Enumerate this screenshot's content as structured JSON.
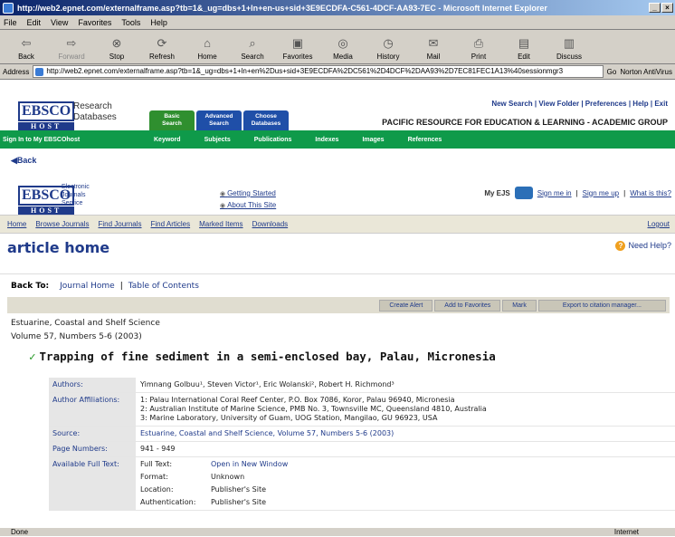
{
  "window": {
    "title": "http://web2.epnet.com/externalframe.asp?tb=1&_ug=dbs+1+ln+en-us+sid+3E9ECDFA-C561-4DCF-AA93-7EC - Microsoft Internet Explorer"
  },
  "menu": [
    "File",
    "Edit",
    "View",
    "Favorites",
    "Tools",
    "Help"
  ],
  "toolbar": [
    "Back",
    "Forward",
    "Stop",
    "Refresh",
    "Home",
    "Search",
    "Favorites",
    "Media",
    "History",
    "Mail",
    "Print",
    "Edit",
    "Discuss"
  ],
  "address": {
    "label": "Address",
    "url": "http://web2.epnet.com/externalframe.asp?tb=1&_ug=dbs+1+ln+en%2Dus+sid+3E9ECDFA%2DC561%2D4DCF%2DAA93%2D7EC81FEC1A13%40sessionmgr3",
    "go": "Go",
    "norton": "Norton AntiVirus"
  },
  "ebsco": {
    "research": "Research",
    "databases": "Databases",
    "tabs": [
      {
        "line1": "Basic",
        "line2": "Search"
      },
      {
        "line1": "Advanced",
        "line2": "Search"
      },
      {
        "line1": "Choose",
        "line2": "Databases"
      }
    ],
    "toplinks": "New Search | View Folder | Preferences | Help | Exit",
    "institution": "PACIFIC RESOURCE FOR EDUCATION & LEARNING - ACADEMIC GROUP",
    "signin": "Sign In to My EBSCOhost",
    "subtabs": [
      "Keyword",
      "Subjects",
      "Publications",
      "Indexes",
      "Images",
      "References"
    ]
  },
  "back": "◀Back",
  "ejs": {
    "label1": "Electronic",
    "label2": "Journals",
    "label3": "Service",
    "getting_started": "Getting Started",
    "about": "About This Site",
    "myejs": "My EJS",
    "signin": "Sign me in",
    "signup": "Sign me up",
    "whatis": "What is this?",
    "nav": [
      "Home",
      "Browse Journals",
      "Find Journals",
      "Find Articles",
      "Marked Items",
      "Downloads"
    ],
    "logout": "Logout"
  },
  "page": {
    "title": "article home",
    "help": "Need Help?",
    "backto_label": "Back To:",
    "journal_home": "Journal Home",
    "toc": "Table of Contents",
    "actions": [
      "Create Alert",
      "Add to Favorites",
      "Mark",
      "Export to citation manager..."
    ],
    "journal": "Estuarine, Coastal and Shelf Science",
    "volume": "Volume 57, Numbers 5-6 (2003)",
    "article_title": "Trapping of fine sediment in a semi-enclosed bay, Palau, Micronesia",
    "authors_label": "Authors:",
    "authors": "Yimnang Golbuu¹, Steven Victor¹, Eric Wolanski², Robert H. Richmond³",
    "affil_label": "Author Affiliations:",
    "affil": [
      "1: Palau International Coral Reef Center, P.O. Box 7086, Koror, Palau 96940, Micronesia",
      "2: Australian Institute of Marine Science, PMB No. 3, Townsville MC, Queensland 4810, Australia",
      "3: Marine Laboratory, University of Guam, UOG Station, Mangilao, GU 96923, USA"
    ],
    "source_label": "Source:",
    "source": "Estuarine, Coastal and Shelf Science, Volume 57, Numbers 5-6 (2003)",
    "pages_label": "Page Numbers:",
    "pages": "941 - 949",
    "fulltext_label": "Available Full Text:",
    "ft": [
      {
        "k": "Full Text:",
        "v": "Open in New Window"
      },
      {
        "k": "Format:",
        "v": "Unknown"
      },
      {
        "k": "Location:",
        "v": "Publisher's Site"
      },
      {
        "k": "Authentication:",
        "v": "Publisher's Site"
      }
    ]
  },
  "status": {
    "text": "Done",
    "zone": "Internet"
  }
}
